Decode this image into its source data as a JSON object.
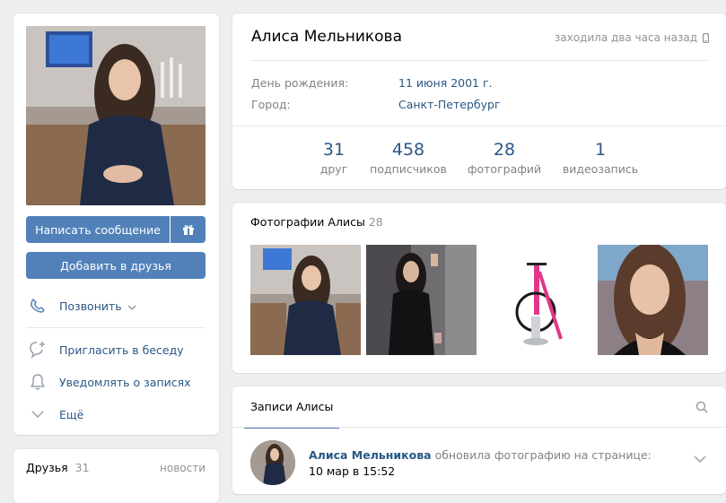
{
  "profile": {
    "name": "Алиса Мельникова",
    "last_seen": "заходила два часа назад",
    "birthday_label": "День рождения:",
    "birthday_value": "11 июня 2001 г.",
    "city_label": "Город:",
    "city_value": "Санкт-Петербург"
  },
  "counters": [
    {
      "value": "31",
      "label": "друг"
    },
    {
      "value": "458",
      "label": "подписчиков"
    },
    {
      "value": "28",
      "label": "фотографий"
    },
    {
      "value": "1",
      "label": "видеозапись"
    }
  ],
  "actions": {
    "message": "Написать сообщение",
    "add_friend": "Добавить в друзья",
    "call": "Позвонить",
    "invite": "Пригласить в беседу",
    "notify": "Уведомлять о записях",
    "more": "Ещё"
  },
  "friends": {
    "title": "Друзья",
    "count": "31",
    "news_link": "новости"
  },
  "photos": {
    "title": "Фотографии Алисы",
    "count": "28"
  },
  "wall": {
    "tab": "Записи Алисы",
    "post": {
      "author": "Алиса Мельникова",
      "action": "обновила фотографию на странице:",
      "time": "10 мар в 15:52"
    }
  },
  "colors": {
    "accent": "#5181b8",
    "link": "#2a5885",
    "background": "#edeef0"
  }
}
